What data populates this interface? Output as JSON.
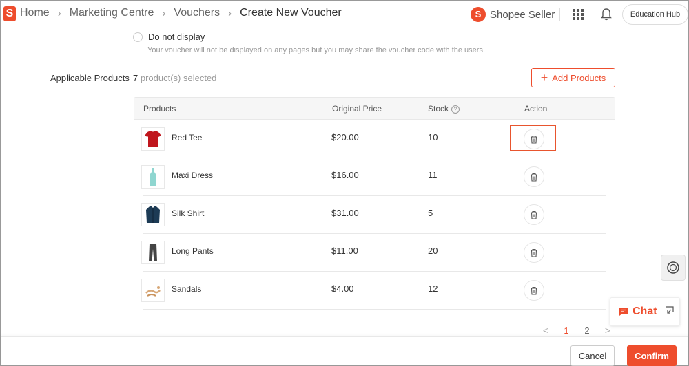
{
  "header": {
    "logo_letter": "S",
    "breadcrumbs": [
      "Home",
      "Marketing Centre",
      "Vouchers",
      "Create New Voucher"
    ],
    "brand": "Shopee Seller",
    "education_hub": "Education Hub"
  },
  "display_option": {
    "label": "Do not display",
    "hint": "Your voucher will not be displayed on any pages but you may share the voucher code with the users."
  },
  "applicable_products": {
    "label": "Applicable Products",
    "count": "7",
    "count_suffix": "product(s) selected",
    "add_button": "Add Products"
  },
  "table": {
    "headers": [
      "Products",
      "Original Price",
      "Stock",
      "Action"
    ],
    "rows": [
      {
        "name": "Red Tee",
        "price": "$20.00",
        "stock": "10"
      },
      {
        "name": "Maxi Dress",
        "price": "$16.00",
        "stock": "11"
      },
      {
        "name": "Silk Shirt",
        "price": "$31.00",
        "stock": "5"
      },
      {
        "name": "Long Pants",
        "price": "$11.00",
        "stock": "20"
      },
      {
        "name": "Sandals",
        "price": "$4.00",
        "stock": "12"
      }
    ]
  },
  "pagination": {
    "prev": "<",
    "pages": [
      "1",
      "2"
    ],
    "current": "1",
    "next": ">"
  },
  "chat": {
    "label": "Chat"
  },
  "footer": {
    "cancel": "Cancel",
    "confirm": "Confirm"
  },
  "colors": {
    "accent": "#ee4d2d",
    "highlight_box": "#e8552e"
  }
}
